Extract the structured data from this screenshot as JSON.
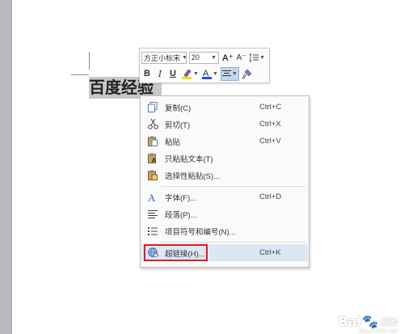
{
  "document": {
    "selected_text": "百度经验"
  },
  "mini_toolbar": {
    "font_name": "方正小标宋",
    "font_size": "20",
    "grow_font_label": "A⁺",
    "shrink_font_label": "A⁻",
    "bold_label": "B",
    "italic_label": "I",
    "underline_label": "U",
    "font_color_label": "A"
  },
  "context_menu": {
    "items": [
      {
        "label": "复制(C)",
        "shortcut": "Ctrl+C",
        "icon": "copy-icon"
      },
      {
        "label": "剪切(T)",
        "shortcut": "Ctrl+X",
        "icon": "scissors-icon"
      },
      {
        "label": "粘贴",
        "shortcut": "Ctrl+V",
        "icon": "paste-icon"
      },
      {
        "label": "只粘贴文本(T)",
        "shortcut": "",
        "icon": "paste-text-icon"
      },
      {
        "label": "选择性粘贴(S)...",
        "shortcut": "",
        "icon": "paste-special-icon"
      },
      {
        "label": "字体(F)...",
        "shortcut": "Ctrl+D",
        "icon": "font-icon"
      },
      {
        "label": "段落(P)...",
        "shortcut": "",
        "icon": "paragraph-icon"
      },
      {
        "label": "项目符号和编号(N)...",
        "shortcut": "",
        "icon": "bullets-icon"
      },
      {
        "label": "超链接(H)...",
        "shortcut": "Ctrl+K",
        "icon": "hyperlink-icon"
      }
    ]
  },
  "watermark": {
    "brand_left": "Bai",
    "brand_right": "经验",
    "url": "jingyan.baidu.com"
  },
  "colors": {
    "highlight_box": "#d4202a",
    "hover_bg": "#dde7f4",
    "font_color_bar": "#2b4fd0",
    "highlight_color_bar": "#e8e000"
  }
}
